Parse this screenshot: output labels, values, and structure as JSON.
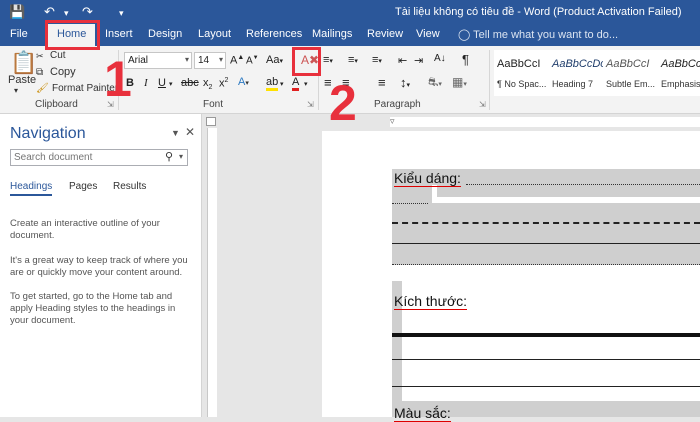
{
  "window": {
    "title": "Tài liệu không có tiêu đề - Word (Product Activation Failed)"
  },
  "tabs": [
    "File",
    "Home",
    "Insert",
    "Design",
    "Layout",
    "References",
    "Mailings",
    "Review",
    "View"
  ],
  "tell_me": "Tell me what you want to do...",
  "ribbon": {
    "clipboard": {
      "paste": "Paste",
      "cut": "Cut",
      "copy": "Copy",
      "format_painter": "Format Painter",
      "label": "Clipboard"
    },
    "font": {
      "name": "Arial",
      "size": "14",
      "label": "Font"
    },
    "paragraph": {
      "label": "Paragraph"
    },
    "styles": [
      {
        "sample": "AaBbCcI",
        "name": "¶ No Spac..."
      },
      {
        "sample": "AaBbCcDc",
        "name": "Heading 7"
      },
      {
        "sample": "AaBbCcI",
        "name": "Subtle Em..."
      },
      {
        "sample": "AaBbCc",
        "name": "Emphasis"
      }
    ]
  },
  "navigation": {
    "title": "Navigation",
    "search_placeholder": "Search document",
    "tabs": [
      "Headings",
      "Pages",
      "Results"
    ],
    "paragraphs": [
      "Create an interactive outline of your document.",
      "It's a great way to keep track of where you are or quickly move your content around.",
      "To get started, go to the Home tab and apply Heading styles to the headings in your document."
    ]
  },
  "document": {
    "lines": [
      "Kiểu dáng:",
      "Kích thước:",
      "Màu sắc:"
    ]
  },
  "annotations": {
    "callout_1": "1",
    "callout_2": "2"
  },
  "colors": {
    "word_blue": "#2b579a",
    "callout_red": "#e8303c"
  }
}
